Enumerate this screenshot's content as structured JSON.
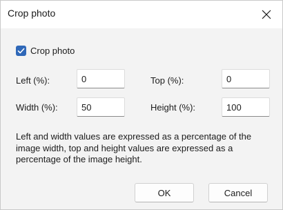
{
  "dialog": {
    "title": "Crop photo",
    "close_icon": "close-icon"
  },
  "crop_checkbox": {
    "label": "Crop photo",
    "checked": true,
    "accent_color": "#2f68b8"
  },
  "fields": {
    "left": {
      "label": "Left (%):",
      "value": "0"
    },
    "top": {
      "label": "Top (%):",
      "value": "0"
    },
    "width": {
      "label": "Width (%):",
      "value": "50"
    },
    "height": {
      "label": "Height (%):",
      "value": "100"
    }
  },
  "info_text": "Left and width values are expressed as a percentage of the image width, top and height values are expressed as a percentage of the image height.",
  "buttons": {
    "ok": "OK",
    "cancel": "Cancel"
  }
}
